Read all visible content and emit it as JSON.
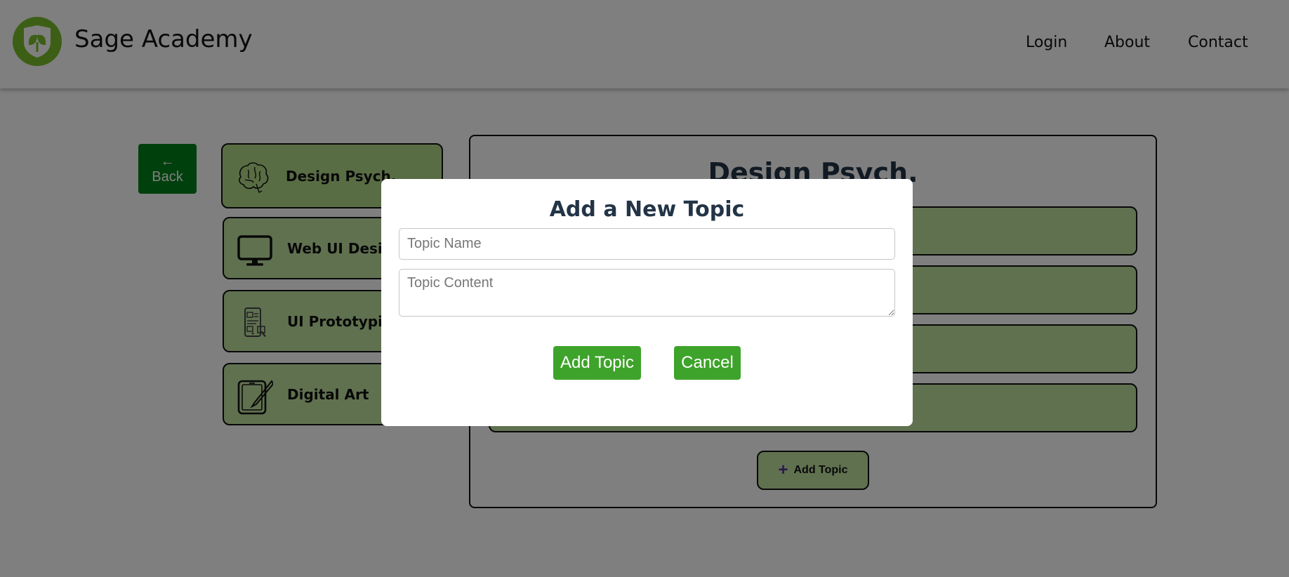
{
  "header": {
    "brand": "Sage Academy",
    "logo_icon": "shield-leaf-icon",
    "nav": [
      {
        "label": "Login"
      },
      {
        "label": "About"
      },
      {
        "label": "Contact"
      }
    ]
  },
  "back": {
    "arrow": "←",
    "label": "Back"
  },
  "subjects": [
    {
      "label": "Design Psych.",
      "icon": "brain-icon",
      "active": true
    },
    {
      "label": "Web UI Design",
      "icon": "monitor-icon"
    },
    {
      "label": "UI Prototyping",
      "icon": "prototype-icon"
    },
    {
      "label": "Digital Art",
      "icon": "tablet-pen-icon"
    }
  ],
  "panel": {
    "title": "Design Psych.",
    "add_topic_label": "Add Topic"
  },
  "modal": {
    "title": "Add a New Topic",
    "topic_name_placeholder": "Topic Name",
    "topic_content_placeholder": "Topic Content",
    "add_button": "Add Topic",
    "cancel_button": "Cancel"
  },
  "colors": {
    "brand_green": "#7bbf2a",
    "back_green": "#00801a",
    "card_green": "#c1e3a0",
    "button_green": "#3ea32a",
    "title_navy": "#233447"
  }
}
